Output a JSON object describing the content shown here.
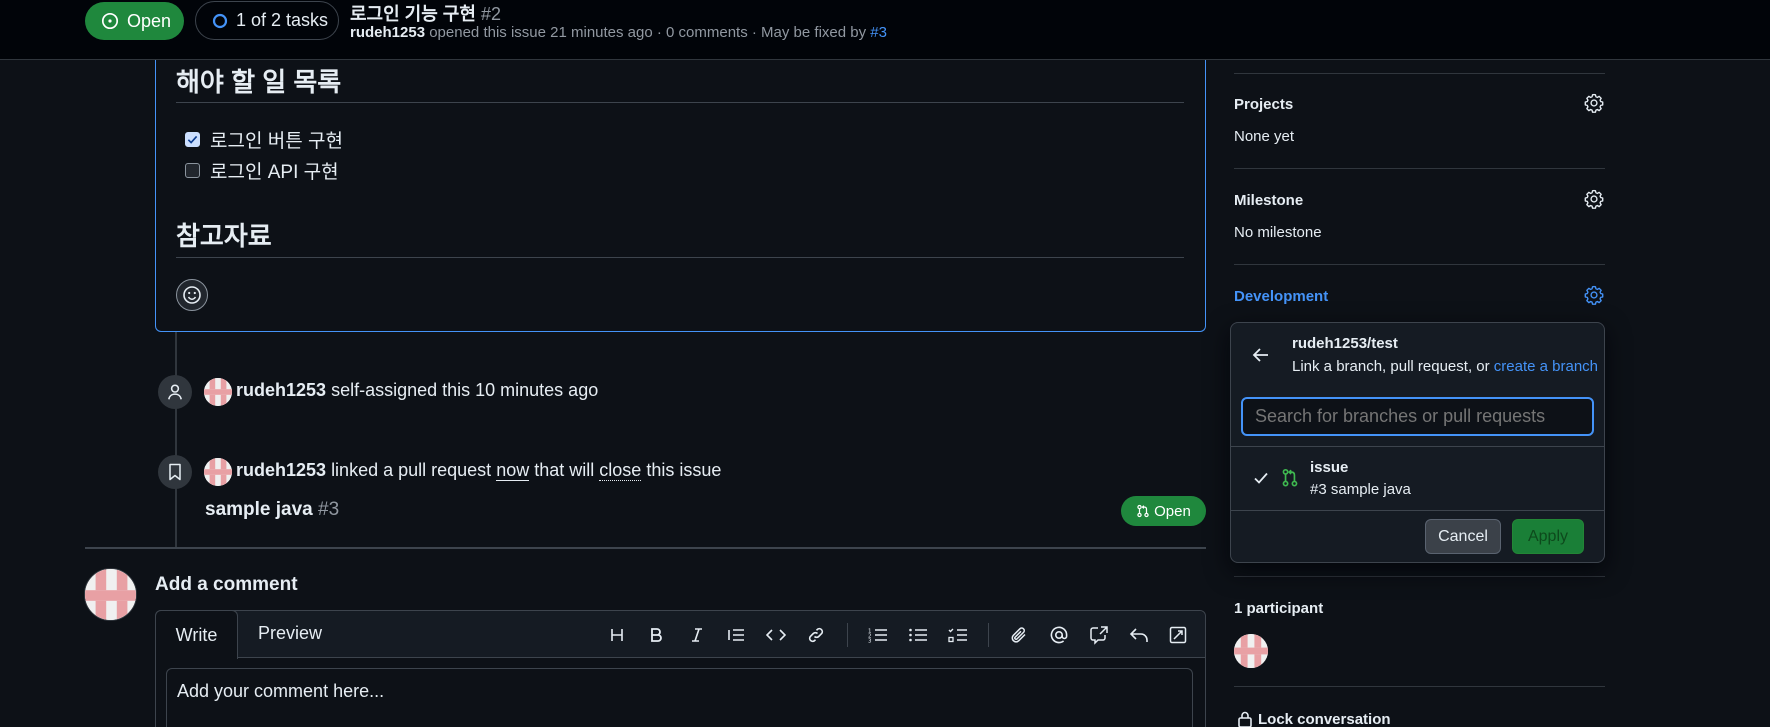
{
  "header": {
    "state_label": "Open",
    "tasks_label": "1 of 2 tasks",
    "issue_title": "로그인 기능 구현",
    "issue_number": "#2",
    "author": "rudeh1253",
    "meta_text": "opened this issue 21 minutes ago · 0 comments · May be fixed by",
    "fixed_by": "#3"
  },
  "body": {
    "todo_heading": "해야 할 일 목록",
    "tasks": [
      {
        "label": "로그인 버튼 구현",
        "checked": true
      },
      {
        "label": "로그인 API 구현",
        "checked": false
      }
    ],
    "ref_heading": "참고자료"
  },
  "timeline": {
    "event1": {
      "user": "rudeh1253",
      "text": "self-assigned this 10 minutes ago"
    },
    "event2": {
      "user": "rudeh1253",
      "text_a": "linked a pull request",
      "now": "now",
      "text_b": "that will",
      "close": "close",
      "text_c": "this issue"
    },
    "pr": {
      "title": "sample java",
      "number": "#3",
      "state": "Open"
    }
  },
  "comment": {
    "heading": "Add a comment",
    "tab_write": "Write",
    "tab_preview": "Preview",
    "placeholder": "Add your comment here..."
  },
  "sidebar": {
    "projects_title": "Projects",
    "projects_value": "None yet",
    "milestone_title": "Milestone",
    "milestone_value": "No milestone",
    "development_title": "Development",
    "participants_label": "1 participant",
    "lock_label": "Lock conversation"
  },
  "dev_panel": {
    "repo": "rudeh1253/test",
    "desc": "Link a branch, pull request, or",
    "create_link": "create a branch",
    "search_placeholder": "Search for branches or pull requests",
    "item_branch": "issue",
    "item_pr": "#3 sample java",
    "cancel": "Cancel",
    "apply": "Apply"
  },
  "colors": {
    "accent": "#4493f8",
    "open_green": "#1f883d",
    "bg": "#0d1117"
  }
}
